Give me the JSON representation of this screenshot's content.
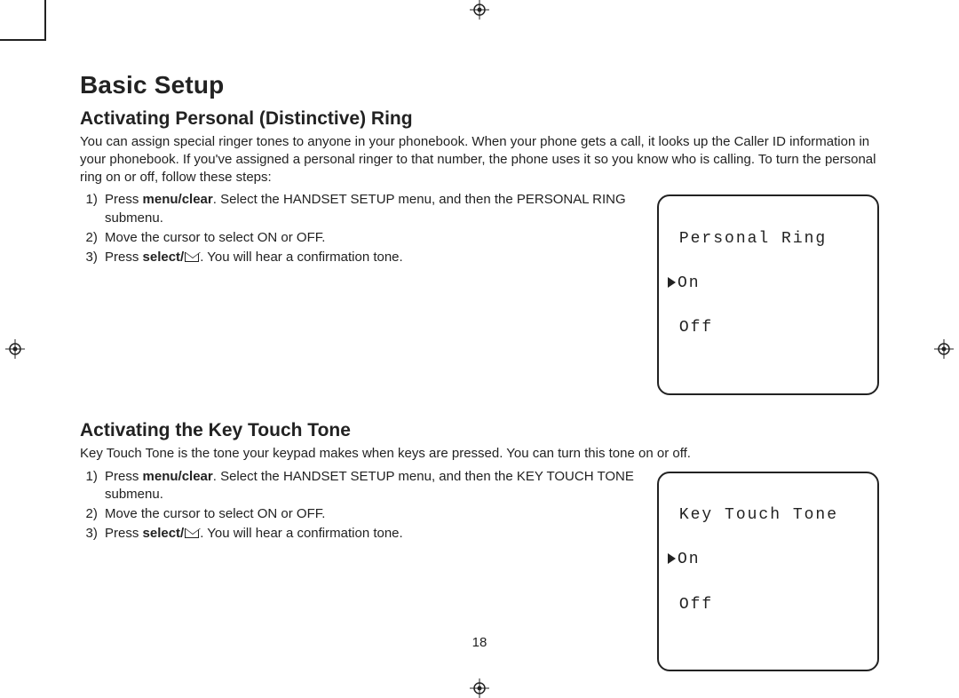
{
  "page_number": "18",
  "title": "Basic Setup",
  "sections": [
    {
      "heading": "Activating Personal (Distinctive) Ring",
      "intro": "You can assign special ringer tones to anyone in your phonebook. When your phone gets a call, it looks up the Caller ID information in your phonebook. If you've assigned a personal ringer to that number, the phone uses it so you know who is calling. To turn the personal ring on or off, follow these steps:",
      "steps": {
        "s1_pre": "Press ",
        "s1_bold": "menu/clear",
        "s1_post": ". Select the HANDSET SETUP menu, and then the PERSONAL RING submenu.",
        "s2": "Move the cursor to select ON or OFF.",
        "s3_pre": "Press ",
        "s3_bold": "select/",
        "s3_post": ". You will hear a confirmation tone."
      },
      "lcd": {
        "title": "Personal Ring",
        "opt1": "On",
        "opt2": "Off"
      }
    },
    {
      "heading": "Activating the Key Touch Tone",
      "intro": "Key Touch Tone is the tone your keypad makes when keys are pressed. You can turn this tone on or off.",
      "steps": {
        "s1_pre": "Press ",
        "s1_bold": "menu/clear",
        "s1_post": ". Select the HANDSET SETUP menu, and then the KEY TOUCH TONE submenu.",
        "s2": "Move the cursor to select ON or OFF.",
        "s3_pre": "Press ",
        "s3_bold": "select/",
        "s3_post": ". You will hear a confirmation tone."
      },
      "lcd": {
        "title": "Key Touch Tone",
        "opt1": "On",
        "opt2": "Off"
      }
    }
  ]
}
